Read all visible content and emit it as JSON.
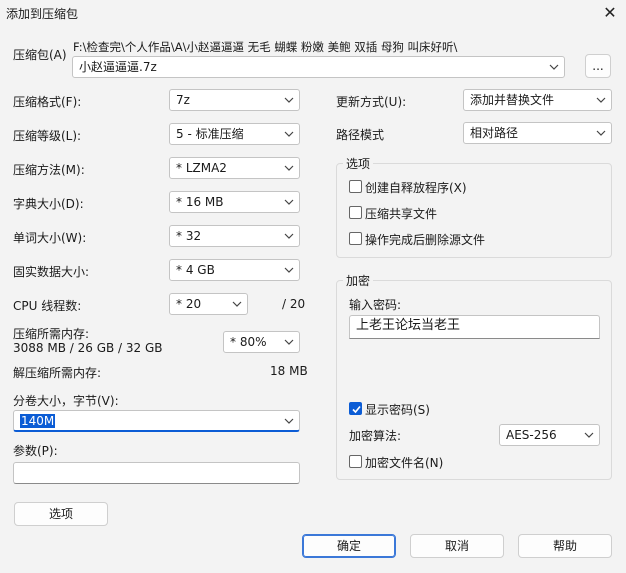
{
  "window": {
    "title": "添加到压缩包",
    "close_glyph": "✕"
  },
  "archive": {
    "label": "压缩包(A)",
    "path": "F:\\检查完\\个人作品\\A\\小赵逼逼逼 无毛 蝴蝶 粉嫩 美鲍 双插 母狗 叫床好听\\",
    "name": "小赵逼逼逼.7z",
    "browse_label": "..."
  },
  "format": {
    "label": "压缩格式(F):",
    "value": "7z"
  },
  "level": {
    "label": "压缩等级(L):",
    "value": "5 - 标准压缩"
  },
  "method": {
    "label": "压缩方法(M):",
    "value": "*  LZMA2"
  },
  "dictionary": {
    "label": "字典大小(D):",
    "value": "*  16 MB"
  },
  "word": {
    "label": "单词大小(W):",
    "value": "*  32"
  },
  "solid": {
    "label": "固实数据大小:",
    "value": "*  4 GB"
  },
  "threads": {
    "label": "CPU 线程数:",
    "value": "*  20",
    "max": "/ 20"
  },
  "memory": {
    "label": "压缩所需内存:",
    "detail": "3088 MB / 26 GB / 32 GB",
    "value": "* 80%"
  },
  "decompress_memory": {
    "label": "解压缩所需内存:",
    "value": "18 MB"
  },
  "volumes": {
    "label": "分卷大小，字节(V):",
    "value": "140M"
  },
  "params": {
    "label": "参数(P):",
    "value": ""
  },
  "options_button": "选项",
  "update": {
    "label": "更新方式(U):",
    "value": "添加并替换文件"
  },
  "path_mode": {
    "label": "路径模式",
    "value": "相对路径"
  },
  "options_group": {
    "title": "选项",
    "sfx": {
      "label": "创建自释放程序(X)",
      "checked": false
    },
    "shared": {
      "label": "压缩共享文件",
      "checked": false
    },
    "delete": {
      "label": "操作完成后删除源文件",
      "checked": false
    }
  },
  "encryption": {
    "title": "加密",
    "password_label": "输入密码:",
    "password": "上老王论坛当老王",
    "show_password": {
      "label": "显示密码(S)",
      "checked": true
    },
    "method_label": "加密算法:",
    "method_value": "AES-256",
    "encrypt_names": {
      "label": "加密文件名(N)",
      "checked": false
    }
  },
  "buttons": {
    "ok": "确定",
    "cancel": "取消",
    "help": "帮助"
  },
  "colors": {
    "accent": "#0b5cd5",
    "background": "#f3f3f3"
  }
}
